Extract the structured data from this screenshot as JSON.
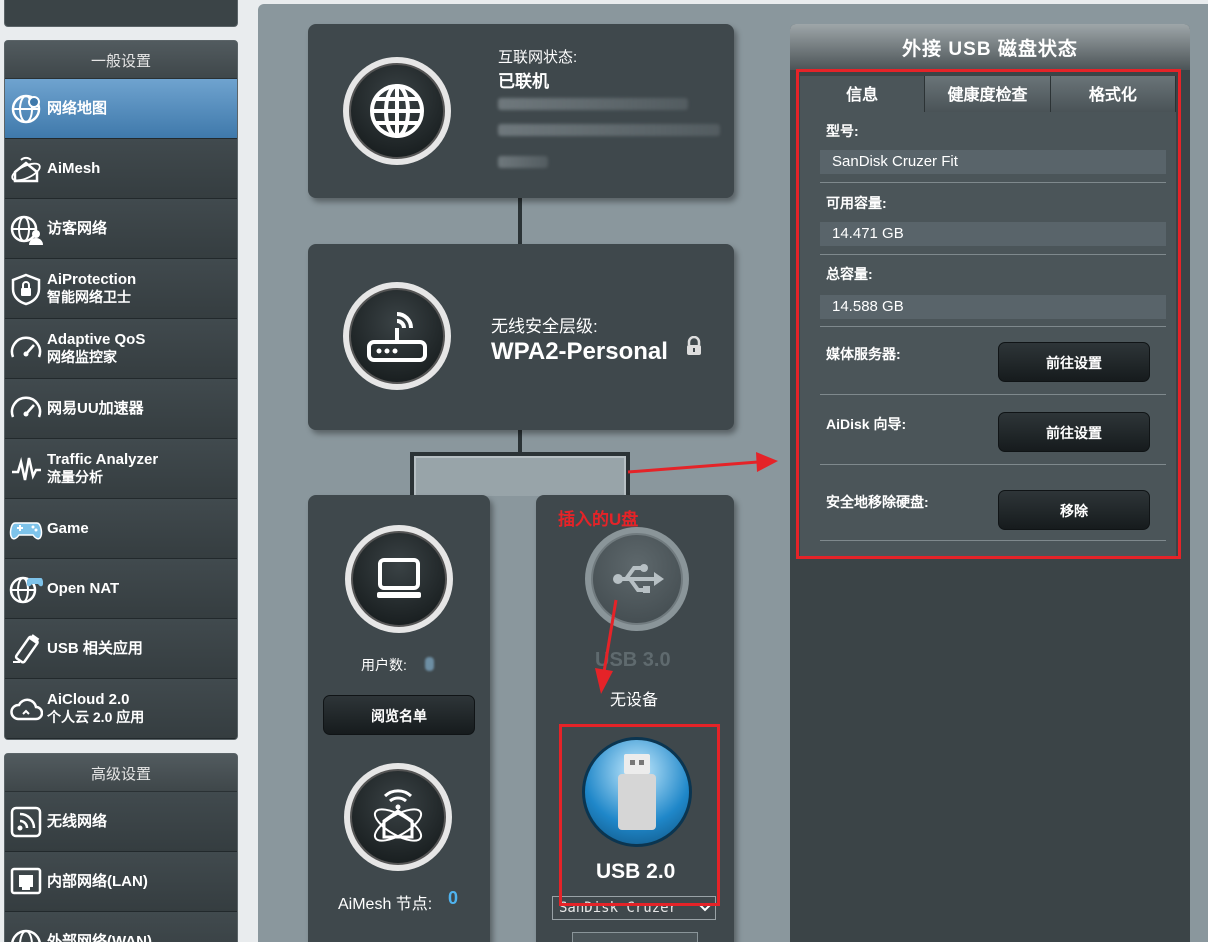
{
  "sidebar": {
    "general_header": "一般设置",
    "general_items": [
      {
        "name": "network-map",
        "label": "网络地图",
        "sub": "",
        "icon": "network-map-icon",
        "active": true
      },
      {
        "name": "aimesh",
        "label": "AiMesh",
        "sub": "",
        "icon": "aimesh-icon",
        "active": false
      },
      {
        "name": "guest-network",
        "label": "访客网络",
        "sub": "",
        "icon": "guest-network-icon",
        "active": false
      },
      {
        "name": "aiprotection",
        "label": "AiProtection",
        "sub": "智能网络卫士",
        "icon": "shield-icon",
        "active": false
      },
      {
        "name": "adaptive-qos",
        "label": "Adaptive QoS",
        "sub": "网络监控家",
        "icon": "speedometer-icon",
        "active": false
      },
      {
        "name": "uu-accelerator",
        "label": "网易UU加速器",
        "sub": "",
        "icon": "speedometer-icon",
        "active": false
      },
      {
        "name": "traffic-analyzer",
        "label": "Traffic Analyzer",
        "sub": "流量分析",
        "icon": "traffic-wave-icon",
        "active": false
      },
      {
        "name": "game",
        "label": "Game",
        "sub": "",
        "icon": "gamepad-icon",
        "active": false
      },
      {
        "name": "open-nat",
        "label": "Open NAT",
        "sub": "",
        "icon": "globe-gamepad-icon",
        "active": false
      },
      {
        "name": "usb-apps",
        "label": "USB 相关应用",
        "sub": "",
        "icon": "usb-stick-icon",
        "active": false
      },
      {
        "name": "aicloud",
        "label": "AiCloud 2.0",
        "sub": "个人云 2.0 应用",
        "icon": "cloud-icon",
        "active": false
      }
    ],
    "advanced_header": "高级设置",
    "advanced_items": [
      {
        "name": "wireless",
        "label": "无线网络",
        "sub": "",
        "icon": "wifi-icon",
        "active": false
      },
      {
        "name": "lan",
        "label": "内部网络(LAN)",
        "sub": "",
        "icon": "lan-icon",
        "active": false
      },
      {
        "name": "wan",
        "label": "外部网络(WAN)",
        "sub": "",
        "icon": "globe-icon",
        "active": false
      }
    ]
  },
  "map": {
    "internet_status_label": "互联网状态:",
    "internet_status_value": "已联机",
    "wireless_security_label": "无线安全层级:",
    "wireless_security_value": "WPA2-Personal",
    "clients_label": "用户数:",
    "clients_button": "阅览名单",
    "aimesh_label": "AiMesh 节点:",
    "aimesh_count": "0",
    "usb3_label": "USB 3.0",
    "usb3_status": "无设备",
    "usb2_label": "USB 2.0",
    "usb2_device_selected": "SanDisk Cruzer"
  },
  "usb_panel": {
    "title": "外接 USB 磁盘状态",
    "tabs": [
      "信息",
      "健康度检查",
      "格式化"
    ],
    "model_label": "型号:",
    "model_value": "SanDisk Cruzer Fit",
    "available_label": "可用容量:",
    "available_value": "14.471 GB",
    "total_label": "总容量:",
    "total_value": "14.588 GB",
    "media_server_label": "媒体服务器:",
    "media_server_button": "前往设置",
    "aidisk_label": "AiDisk 向导:",
    "aidisk_button": "前往设置",
    "remove_label": "安全地移除硬盘:",
    "remove_button": "移除"
  },
  "annotation": {
    "text": "插入的U盘",
    "color": "#e52328"
  }
}
